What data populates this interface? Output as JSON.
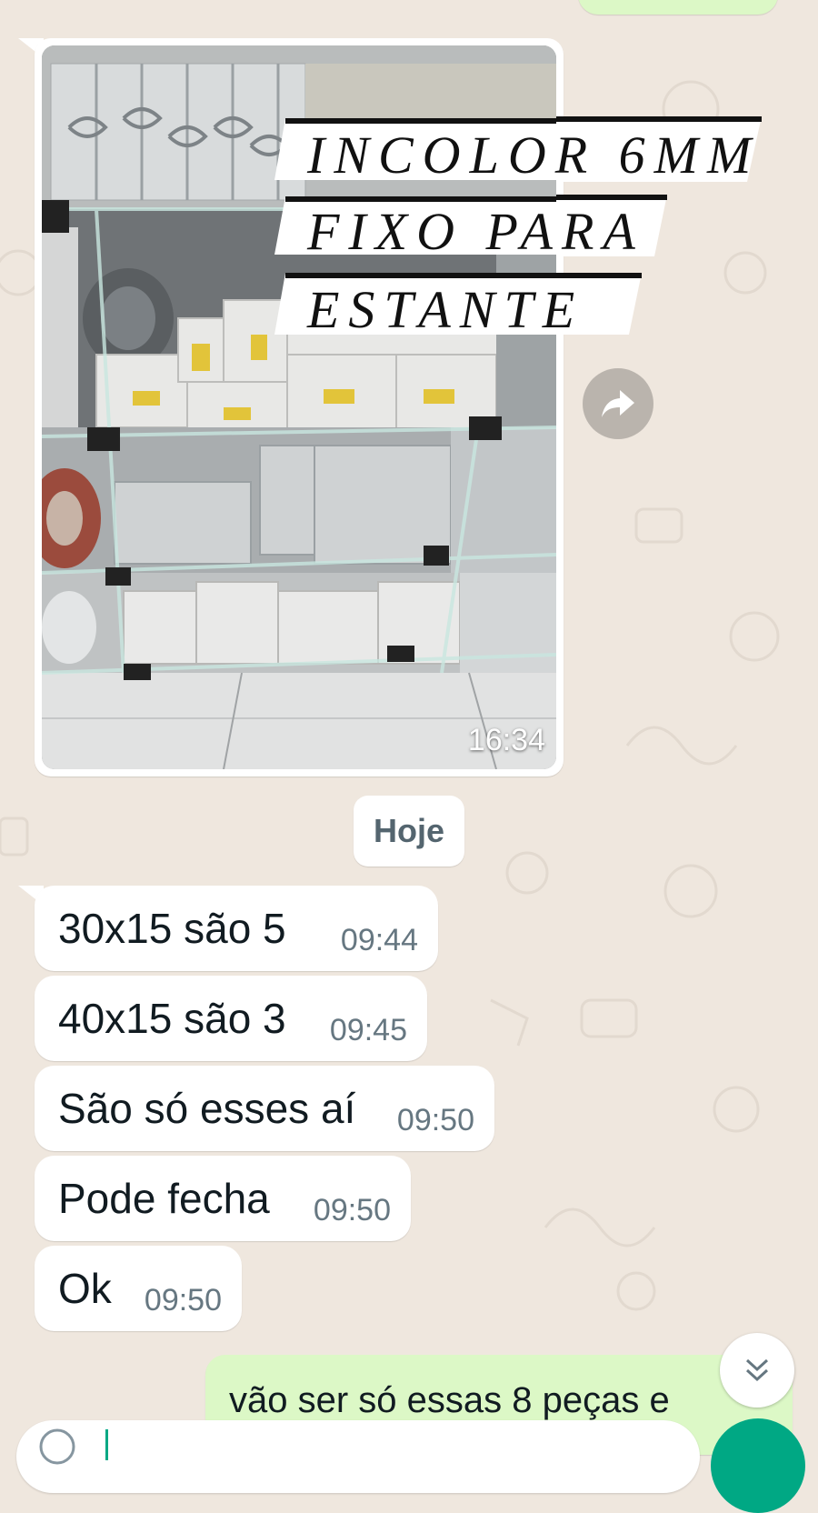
{
  "image_message": {
    "overlay_lines": [
      "INCOLOR 6MM",
      "FIXO PARA",
      "ESTANTE"
    ],
    "time": "16:34",
    "forward_icon": "share-arrow-icon"
  },
  "date_separator": "Hoje",
  "incoming_messages": [
    {
      "text": "30x15  são 5",
      "time": "09:44"
    },
    {
      "text": "40x15 são 3",
      "time": "09:45"
    },
    {
      "text": "São só esses aí",
      "time": "09:50"
    },
    {
      "text": "Pode fecha",
      "time": "09:50"
    },
    {
      "text": "Ok",
      "time": "09:50"
    }
  ],
  "outgoing_message": {
    "text": "vão ser só essas 8 peças e"
  },
  "scroll_icon": "double-chevron-down-icon",
  "colors": {
    "background": "#efe7de",
    "incoming": "#ffffff",
    "outgoing": "#dcf8c6",
    "accent": "#00a884"
  }
}
